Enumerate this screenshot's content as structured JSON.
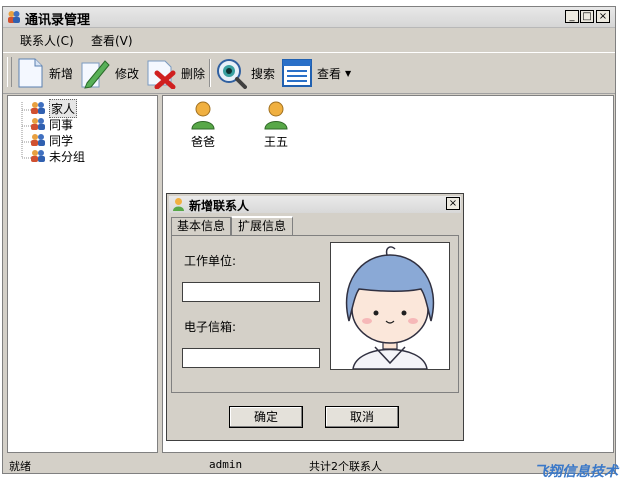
{
  "window": {
    "title": "通讯录管理",
    "minimize": "_",
    "maximize": "□",
    "close": "×"
  },
  "menu": [
    "联系人(C)",
    "查看(V)"
  ],
  "toolbar": {
    "add": "新增",
    "edit": "修改",
    "delete": "删除",
    "search": "搜索",
    "view": "查看"
  },
  "tree": [
    "家人",
    "同事",
    "同学",
    "未分组"
  ],
  "contacts": [
    "爸爸",
    "王五"
  ],
  "status": {
    "ready": "就绪",
    "user": "admin",
    "count": "共计2个联系人"
  },
  "dialog": {
    "title": "新增联系人",
    "tabs": [
      "基本信息",
      "扩展信息"
    ],
    "work_label": "工作单位:",
    "work_value": "",
    "email_label": "电子信箱:",
    "email_value": "",
    "ok": "确定",
    "cancel": "取消"
  },
  "brand": "飞翔信息技术",
  "colors": {
    "brand": "#3a78c8",
    "panel": "#d4d0c8",
    "hair": "#8aa9d6"
  },
  "icons": [
    "contacts-app-icon",
    "new-document-icon",
    "edit-pen-icon",
    "delete-x-icon",
    "search-eye-icon",
    "view-list-icon",
    "group-icon",
    "person-icon"
  ]
}
